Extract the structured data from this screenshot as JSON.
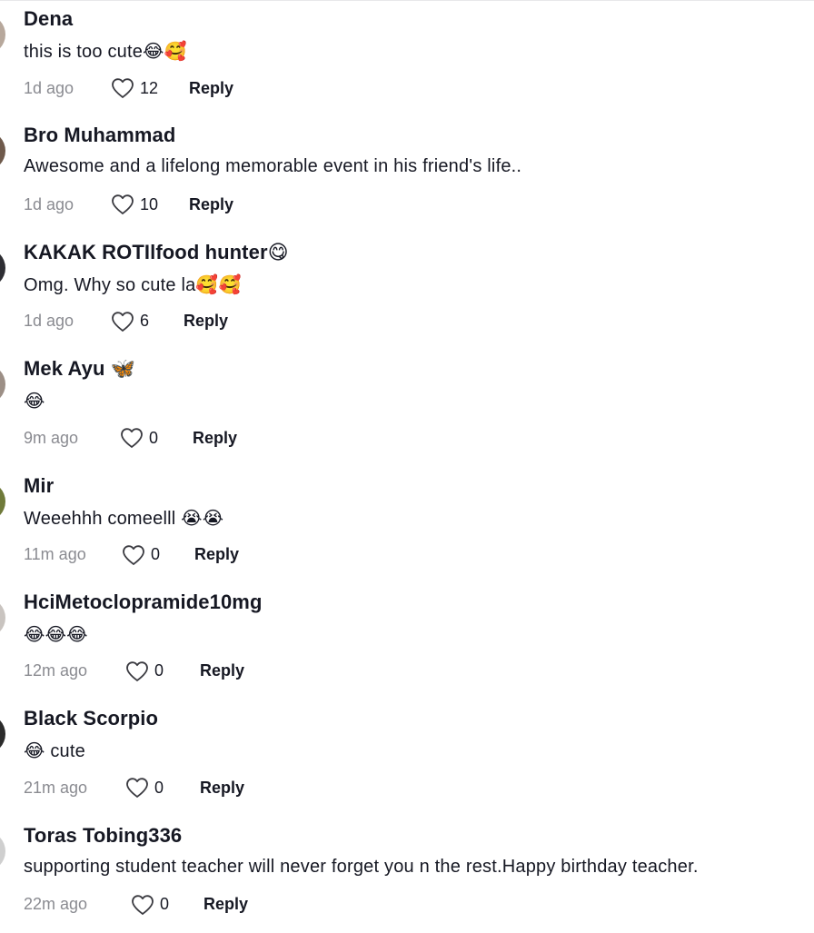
{
  "comments": [
    {
      "username": "Dena",
      "text": "this is too cute😂🥰",
      "time": "1d ago",
      "likes": "12",
      "reply": "Reply",
      "avatar_color": "#b7a89c"
    },
    {
      "username": "Bro Muhammad",
      "text": "Awesome and a lifelong memorable event in his friend's life..",
      "time": "1d ago",
      "likes": "10",
      "reply": "Reply",
      "avatar_color": "#6f5a4c"
    },
    {
      "username": "KAKAK ROTIlfood hunter😋",
      "text": "Omg. Why so cute la🥰🥰",
      "time": "1d ago",
      "likes": "6",
      "reply": "Reply",
      "avatar_color": "#2e2e33"
    },
    {
      "username": "Mek Ayu 🦋",
      "text": "😂",
      "time": "9m ago",
      "likes": "0",
      "reply": "Reply",
      "avatar_color": "#9c8f86"
    },
    {
      "username": "Mir",
      "text": "Weeehhh comeelll 😭😭",
      "time": "11m ago",
      "likes": "0",
      "reply": "Reply",
      "avatar_color": "#6f7a3a"
    },
    {
      "username": "HciMetoclopramide10mg",
      "text": "😂😂😂",
      "time": "12m ago",
      "likes": "0",
      "reply": "Reply",
      "avatar_color": "#c9c4c0"
    },
    {
      "username": "Black Scorpio",
      "text": "😂 cute",
      "time": "21m ago",
      "likes": "0",
      "reply": "Reply",
      "avatar_color": "#2b2b2b"
    },
    {
      "username": "Toras Tobing336",
      "text": "supporting student teacher will never forget you n the rest.Happy birthday teacher.",
      "time": "22m ago",
      "likes": "0",
      "reply": "Reply",
      "avatar_color": "#cfcfcf"
    }
  ],
  "icons": {
    "like": "heart-outline-icon"
  },
  "colors": {
    "text": "#161823",
    "muted": "#8a8b91"
  }
}
